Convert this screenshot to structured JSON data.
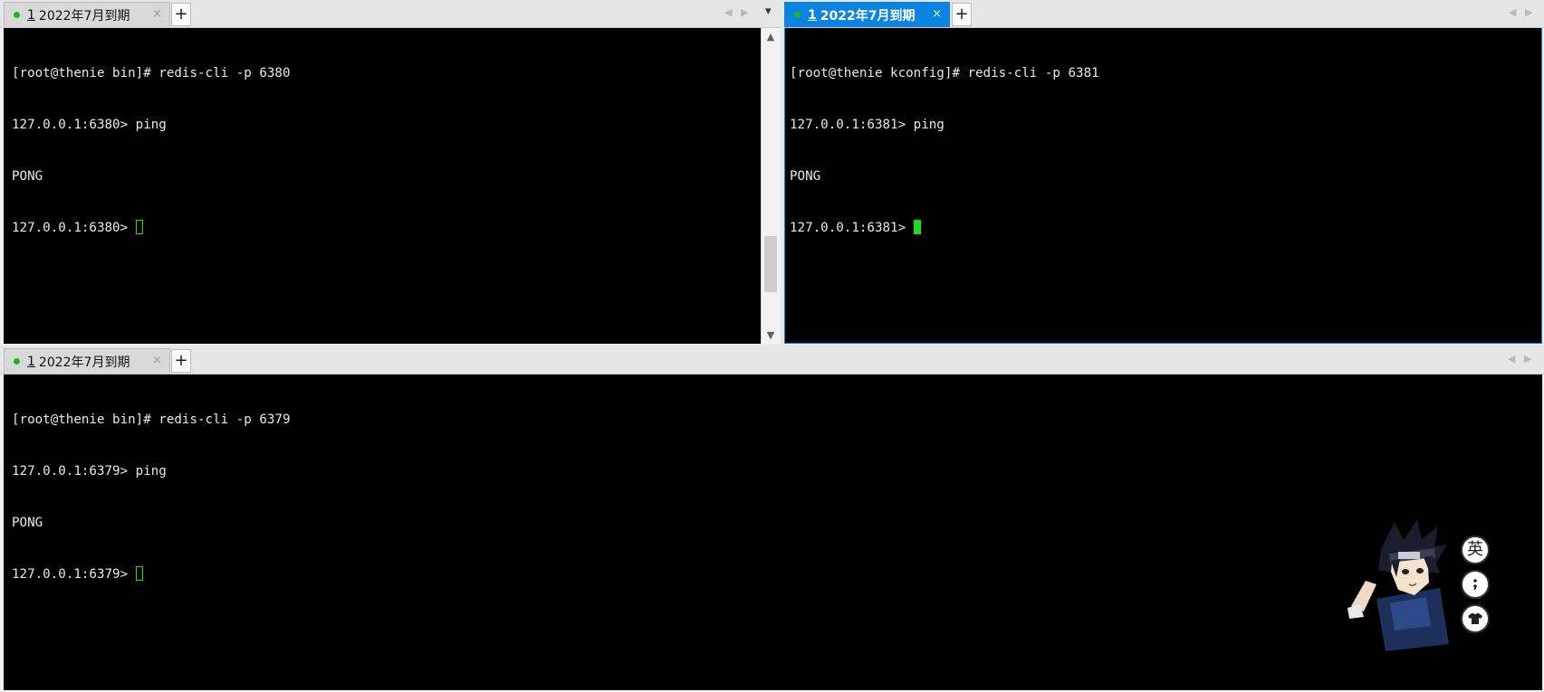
{
  "panes": {
    "top_left": {
      "tab": {
        "status_dot": "green-dot-icon",
        "index": "1",
        "title": "2022年7月到期",
        "close": "×"
      },
      "add_tab": "+",
      "dropdown": "▾",
      "nav": {
        "left": "◀",
        "right": "▶"
      },
      "lines": [
        "[root@thenie bin]# redis-cli -p 6380",
        "127.0.0.1:6380> ping",
        "PONG",
        "127.0.0.1:6380> "
      ],
      "scrollbar": {
        "up": "▲",
        "down": "▼",
        "position": 0.85
      }
    },
    "top_right": {
      "tab": {
        "status_dot": "green-dot-icon",
        "index": "1",
        "title": "2022年7月到期",
        "close": "×"
      },
      "add_tab": "+",
      "nav": {
        "left": "◀",
        "right": "▶"
      },
      "lines": [
        "[root@thenie kconfig]# redis-cli -p 6381",
        "127.0.0.1:6381> ping",
        "PONG",
        "127.0.0.1:6381> "
      ]
    },
    "bottom": {
      "tab": {
        "status_dot": "green-dot-icon",
        "index": "1",
        "title": "2022年7月到期",
        "close": "×"
      },
      "add_tab": "+",
      "nav": {
        "left": "◀",
        "right": "▶"
      },
      "lines": [
        "[root@thenie bin]# redis-cli -p 6379",
        "127.0.0.1:6379> ping",
        "PONG",
        "127.0.0.1:6379> "
      ]
    }
  },
  "ime_widget": {
    "lang_label": "英",
    "punct_icon": "punctuation-icon",
    "skin_icon": "shirt-icon"
  },
  "colors": {
    "terminal_bg": "#000000",
    "terminal_fg": "#e8e8e8",
    "cursor": "#18e018",
    "active_tab": "#0a84e0",
    "status_dot": "#1db81d"
  }
}
